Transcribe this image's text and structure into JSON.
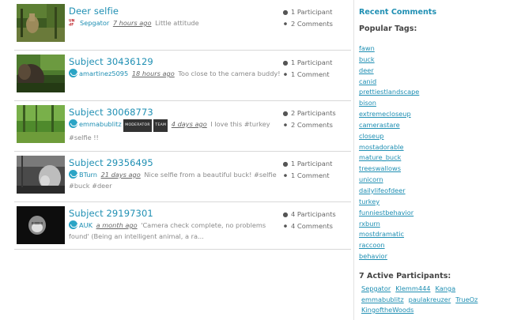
{
  "threads": [
    {
      "title": "Deer selfie",
      "user": "Sepgator",
      "time": "7 hours ago",
      "comment": "Little attitude",
      "badges": [],
      "participants": "1 Participant",
      "comments": "2 Comments"
    },
    {
      "title": "Subject 30436129",
      "user": "amartinez5095",
      "time": "18 hours ago",
      "comment": "Too close to the camera buddy!",
      "badges": [],
      "participants": "1 Participant",
      "comments": "1 Comment"
    },
    {
      "title": "Subject 30068773",
      "user": "emmabublitz",
      "time": "4 days ago",
      "comment": "I love this #turkey #selfie !!",
      "badges": [
        "MODERATOR",
        "TEAM"
      ],
      "participants": "2 Participants",
      "comments": "2 Comments"
    },
    {
      "title": "Subject 29356495",
      "user": "BTurn",
      "time": "21 days ago",
      "comment": "Nice selfie from a beautiful buck! #selfie #buck #deer",
      "badges": [],
      "participants": "1 Participant",
      "comments": "1 Comment"
    },
    {
      "title": "Subject 29197301",
      "user": "AUK",
      "time": "a month ago",
      "comment": "'Camera check complete, no problems found' (Being an intelligent animal, a ra...",
      "badges": [],
      "participants": "4 Participants",
      "comments": "4 Comments"
    }
  ],
  "sidebar": {
    "recent_comments": "Recent Comments",
    "popular_tags_heading": "Popular Tags:",
    "tags": [
      "fawn",
      "buck",
      "deer",
      "canid",
      "prettiestlandscape",
      "bison",
      "extremecloseup",
      "camerastare",
      "closeup",
      "mostadorable",
      "mature_buck",
      "treeswallows",
      "unicorn",
      "dailylifeofdeer",
      "turkey",
      "funniestbehavior",
      "rxburn",
      "mostdramatic",
      "raccoon",
      "behavior"
    ],
    "active_heading": "7 Active Participants:",
    "participants": [
      "Sepgator",
      "Klemm444",
      "Kanga",
      "emmabublitz",
      "paulakreuzer",
      "TrueOz",
      "KingoftheWoods"
    ]
  },
  "colors": {
    "link": "#1f8fb3",
    "text": "#555555",
    "divider": "#d8d8d8"
  },
  "icons": {
    "participants": "user-icon",
    "comments": "speech-bubble-icon"
  }
}
